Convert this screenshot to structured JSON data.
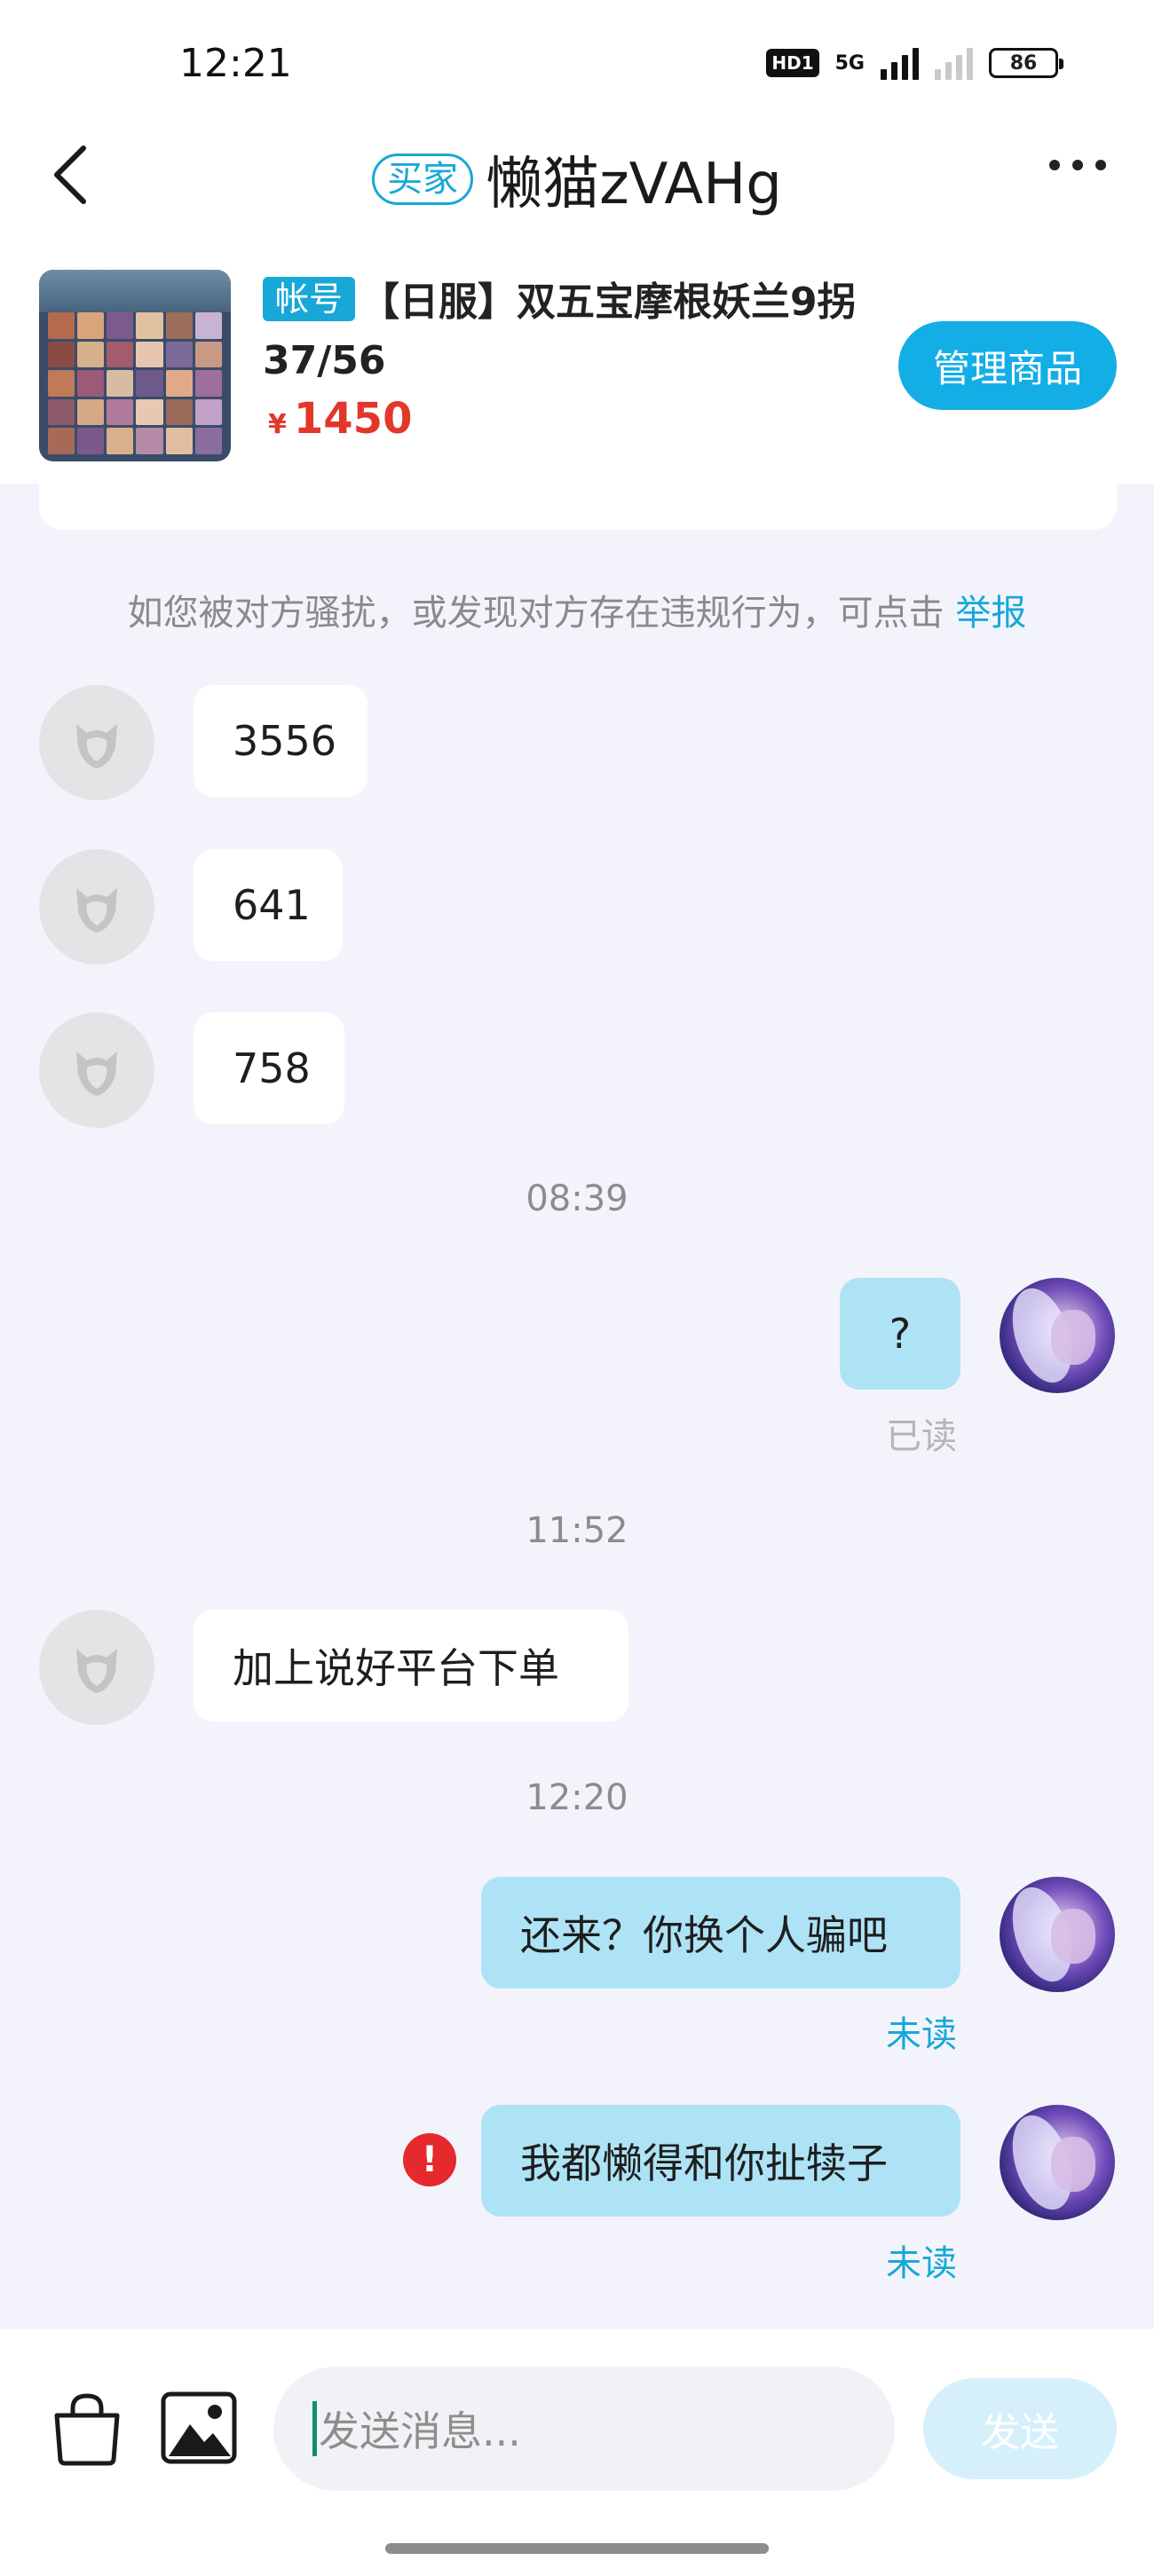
{
  "status_bar": {
    "time": "12:21",
    "hd_label": "HD1",
    "network_label": "5G",
    "battery": "86"
  },
  "header": {
    "role_tag": "买家",
    "title": "懒猫zVAHg"
  },
  "product": {
    "tag": "帐号",
    "title": "【日服】双五宝摩根妖兰9拐37/56",
    "currency": "¥",
    "price": "1450",
    "manage_label": "管理商品"
  },
  "notice": {
    "text": "如您被对方骚扰，或发现对方存在违规行为，可点击",
    "report_label": "举报"
  },
  "messages": {
    "m1": "3556",
    "m2": "641",
    "m3": "758",
    "t1": "08:39",
    "m4": "?",
    "m4_status": "已读",
    "t2": "11:52",
    "m5": "加上说好平台下单",
    "t3": "12:20",
    "m6": "还来？你换个人骗吧",
    "m6_status": "未读",
    "m7": "我都懒得和你扯犊子",
    "m7_status": "未读",
    "error_mark": "!"
  },
  "input": {
    "placeholder": "发送消息...",
    "send_label": "发送"
  },
  "colors": {
    "accent": "#18a8d8",
    "price": "#e2372a",
    "outgoing_bubble": "#aee3f6",
    "chat_bg": "#f3f4fb",
    "error": "#e5292d"
  },
  "icons": [
    "back-arrow-icon",
    "more-dots-icon",
    "default-avatar-icon",
    "error-icon",
    "shopping-bag-icon",
    "image-icon"
  ]
}
